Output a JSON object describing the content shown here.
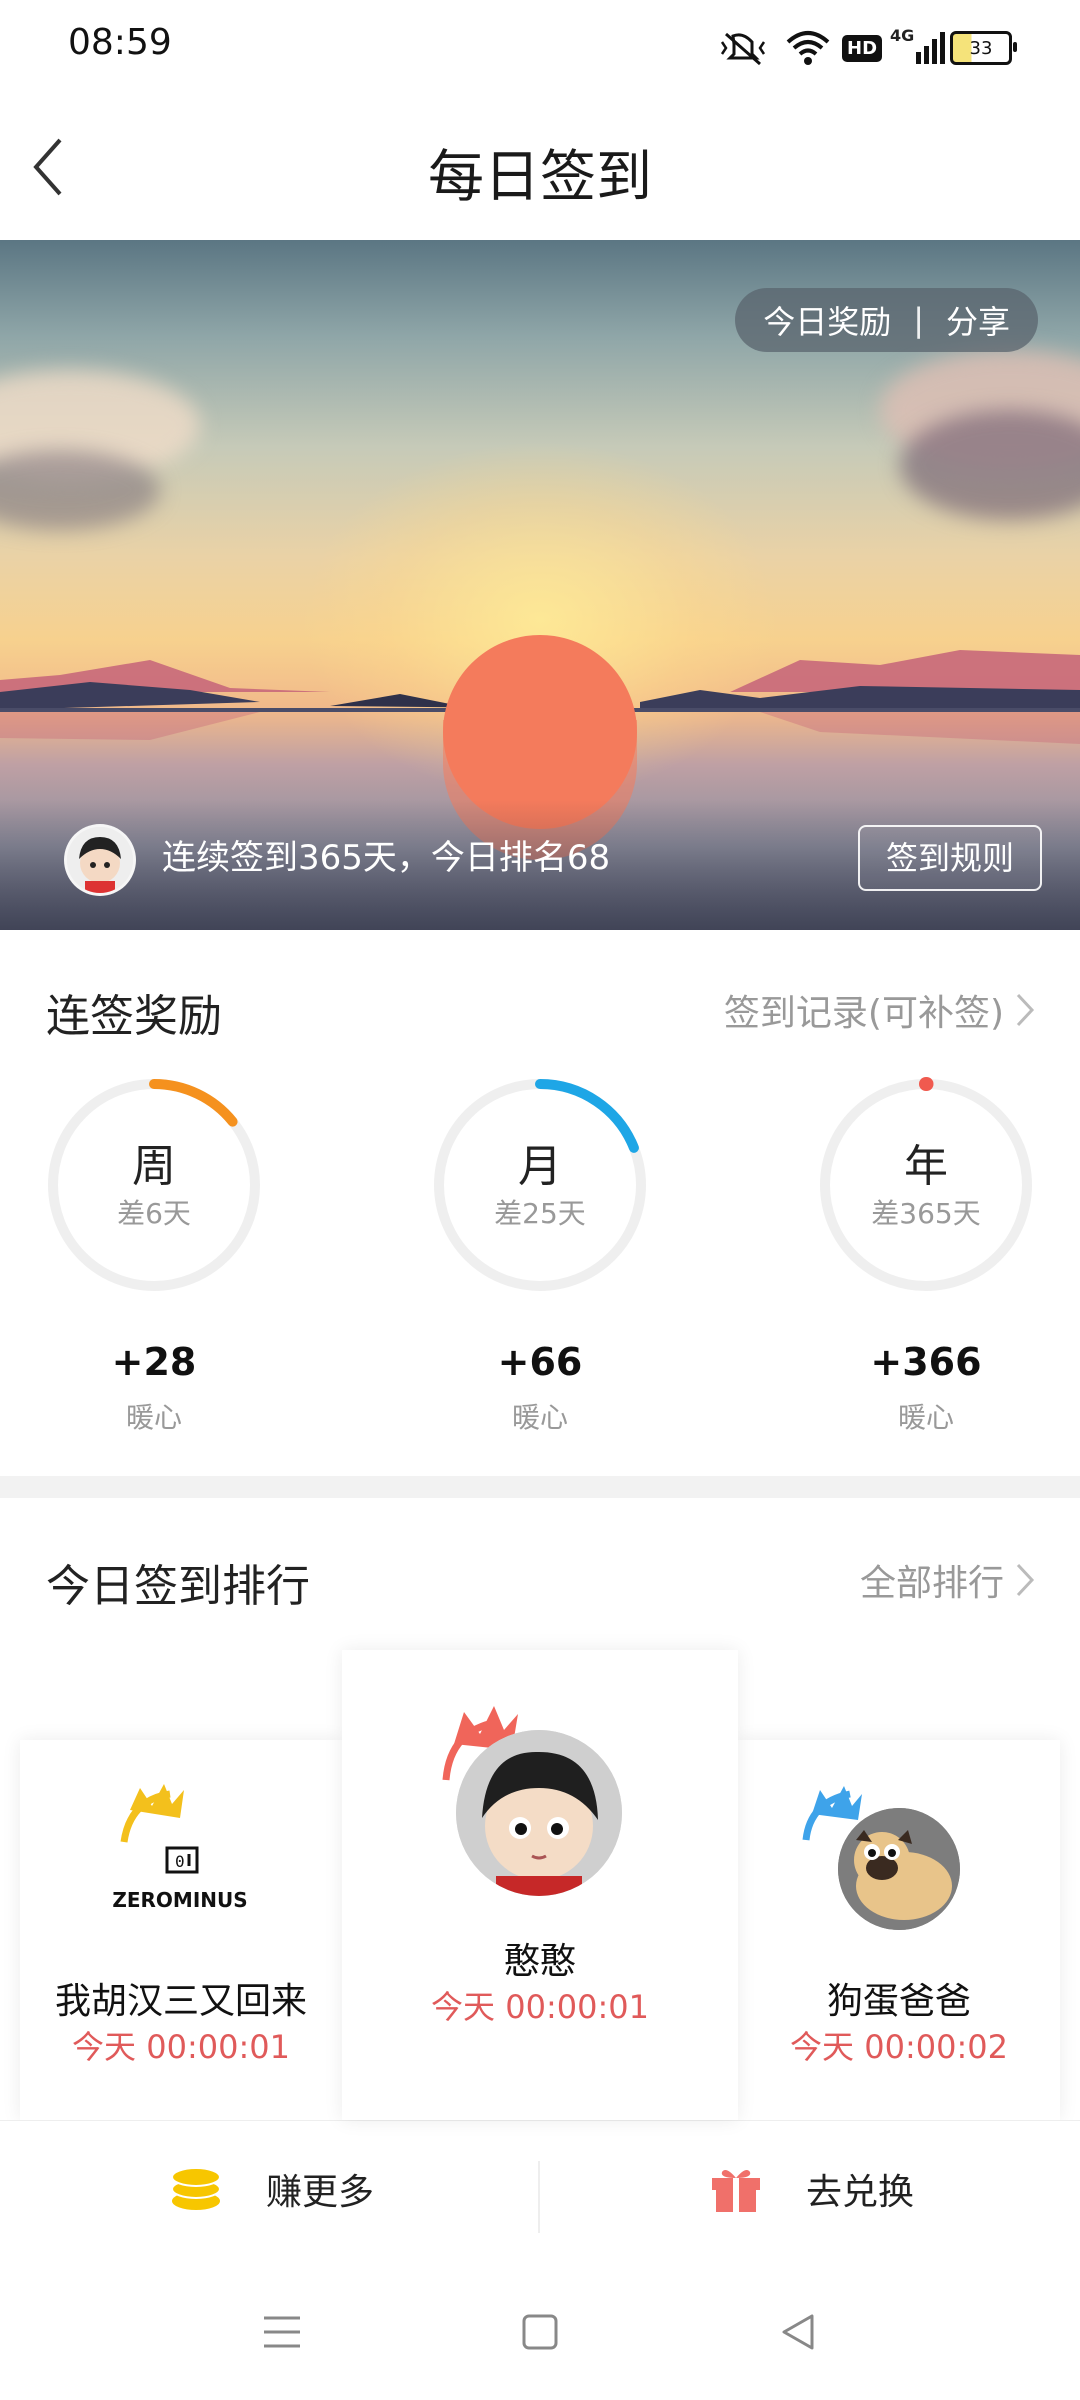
{
  "status_bar": {
    "time": "08:59",
    "network": "4G",
    "hd": "HD",
    "battery": "33"
  },
  "header": {
    "title": "每日签到",
    "back_icon": "back-arrow-icon"
  },
  "hero": {
    "reward_label": "今日奖励",
    "separator": "|",
    "share_label": "分享",
    "streak_text": "连续签到365天，今日排名68",
    "rules_button": "签到规则"
  },
  "streak": {
    "title": "连签奖励",
    "record_link": "签到记录(可补签)",
    "rings": [
      {
        "label": "周",
        "remaining": "差6天",
        "value": "+28",
        "unit": "暖心",
        "color": "#f5911e",
        "progress": 0.142
      },
      {
        "label": "月",
        "remaining": "差25天",
        "value": "+66",
        "unit": "暖心",
        "color": "#1ea6e6",
        "progress": 0.19
      },
      {
        "label": "年",
        "remaining": "差365天",
        "value": "+366",
        "unit": "暖心",
        "color": "#f05a4f",
        "progress": 0.0
      }
    ]
  },
  "ranking": {
    "title": "今日签到排行",
    "all_link": "全部排行",
    "entries": [
      {
        "rank": 2,
        "name": "我胡汉三又回来",
        "time": "今天 00:00:01",
        "avatar_text": "ZEROMINUS",
        "crown_color": "#f3c01c"
      },
      {
        "rank": 1,
        "name": "憨憨",
        "time": "今天 00:00:01",
        "crown_color": "#f0655a"
      },
      {
        "rank": 3,
        "name": "狗蛋爸爸",
        "time": "今天 00:00:02",
        "crown_color": "#3ea3ea"
      }
    ]
  },
  "bottom_actions": {
    "earn_label": "赚更多",
    "exchange_label": "去兑换"
  },
  "colors": {
    "accent_red": "#e05a5a",
    "coin_yellow": "#f7c600",
    "gift_red": "#f0706a"
  }
}
